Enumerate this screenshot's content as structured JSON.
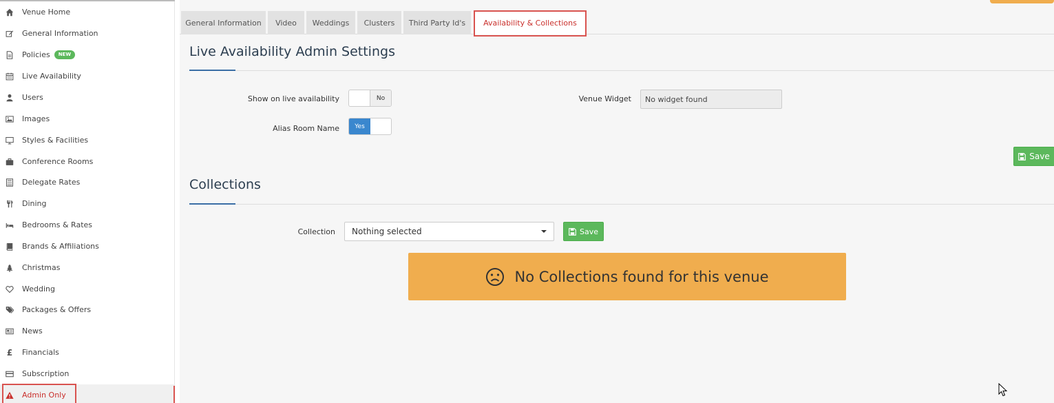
{
  "sidebar": {
    "items": [
      {
        "label": "Venue Home",
        "icon": "home-icon"
      },
      {
        "label": "General Information",
        "icon": "edit-icon"
      },
      {
        "label": "Policies",
        "icon": "document-icon",
        "badge": "NEW"
      },
      {
        "label": "Live Availability",
        "icon": "calendar-icon"
      },
      {
        "label": "Users",
        "icon": "user-icon"
      },
      {
        "label": "Images",
        "icon": "image-icon"
      },
      {
        "label": "Styles & Facilities",
        "icon": "monitor-icon"
      },
      {
        "label": "Conference Rooms",
        "icon": "briefcase-icon"
      },
      {
        "label": "Delegate Rates",
        "icon": "calculator-icon"
      },
      {
        "label": "Dining",
        "icon": "cutlery-icon"
      },
      {
        "label": "Bedrooms & Rates",
        "icon": "bed-icon"
      },
      {
        "label": "Brands & Affiliations",
        "icon": "book-icon"
      },
      {
        "label": "Christmas",
        "icon": "tree-icon"
      },
      {
        "label": "Wedding",
        "icon": "heart-icon"
      },
      {
        "label": "Packages & Offers",
        "icon": "tags-icon"
      },
      {
        "label": "News",
        "icon": "newspaper-icon"
      },
      {
        "label": "Financials",
        "icon": "pound-icon"
      },
      {
        "label": "Subscription",
        "icon": "credit-card-icon"
      },
      {
        "label": "Admin Only",
        "icon": "warning-icon"
      }
    ]
  },
  "tabs": [
    {
      "label": "General Information"
    },
    {
      "label": "Video"
    },
    {
      "label": "Weddings"
    },
    {
      "label": "Clusters"
    },
    {
      "label": "Third Party Id's"
    },
    {
      "label": "Availability & Collections",
      "active": true
    }
  ],
  "availability": {
    "title": "Live Availability Admin Settings",
    "show_label": "Show on live availability",
    "show_value": "No",
    "alias_label": "Alias Room Name",
    "alias_value": "Yes",
    "widget_label": "Venue Widget",
    "widget_value": "No widget found",
    "save_label": "Save"
  },
  "collections": {
    "title": "Collections",
    "collection_label": "Collection",
    "collection_selected": "Nothing selected",
    "save_label": "Save",
    "alert_text": "No Collections found for this venue"
  },
  "colors": {
    "accent_red": "#d9534f",
    "save_green": "#5cb85c",
    "alert_orange": "#f0ad4e",
    "toggle_blue": "#3a87ce"
  }
}
